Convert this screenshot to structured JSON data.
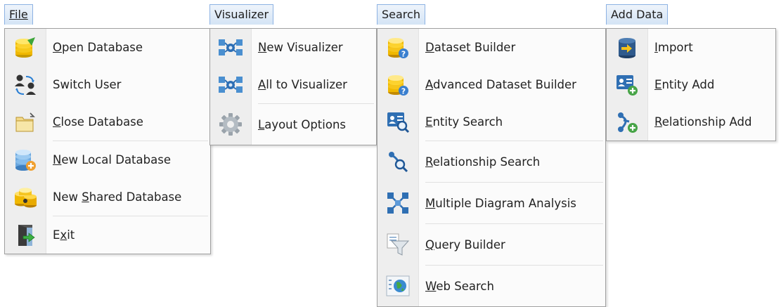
{
  "menus": {
    "file": {
      "title": "File",
      "items": [
        {
          "label": "Open Database",
          "mnemonic": "O",
          "icon": "open-database-icon"
        },
        {
          "label": "Switch User",
          "mnemonic": "",
          "icon": "switch-user-icon"
        },
        {
          "label": "Close Database",
          "mnemonic": "C",
          "icon": "close-database-icon"
        },
        {
          "label": "New Local Database",
          "mnemonic": "N",
          "icon": "new-local-database-icon"
        },
        {
          "label": "New Shared Database",
          "mnemonic": "S",
          "icon": "new-shared-database-icon"
        },
        {
          "label": "Exit",
          "mnemonic": "x",
          "icon": "exit-icon"
        }
      ]
    },
    "visualizer": {
      "title": "Visualizer",
      "items": [
        {
          "label": "New Visualizer",
          "mnemonic": "N",
          "icon": "new-visualizer-icon"
        },
        {
          "label": "All to Visualizer",
          "mnemonic": "A",
          "icon": "all-to-visualizer-icon"
        },
        {
          "label": "Layout Options",
          "mnemonic": "L",
          "icon": "gear-icon"
        }
      ]
    },
    "search": {
      "title": "Search",
      "items": [
        {
          "label": "Dataset Builder",
          "mnemonic": "D",
          "icon": "dataset-builder-icon"
        },
        {
          "label": "Advanced Dataset Builder",
          "mnemonic": "A",
          "icon": "advanced-dataset-builder-icon"
        },
        {
          "label": "Entity Search",
          "mnemonic": "E",
          "icon": "entity-search-icon"
        },
        {
          "label": "Relationship Search",
          "mnemonic": "R",
          "icon": "relationship-search-icon"
        },
        {
          "label": "Multiple Diagram Analysis",
          "mnemonic": "M",
          "icon": "multiple-diagram-icon"
        },
        {
          "label": "Query Builder",
          "mnemonic": "Q",
          "icon": "funnel-icon"
        },
        {
          "label": "Web Search",
          "mnemonic": "W",
          "icon": "globe-icon"
        }
      ]
    },
    "add_data": {
      "title": "Add Data",
      "items": [
        {
          "label": "Import",
          "mnemonic": "I",
          "icon": "import-icon"
        },
        {
          "label": "Entity Add",
          "mnemonic": "E",
          "icon": "entity-add-icon"
        },
        {
          "label": "Relationship Add",
          "mnemonic": "R",
          "icon": "relationship-add-icon"
        }
      ]
    }
  },
  "colors": {
    "menu_highlight": "#d4e4f5",
    "menu_border": "#8db2e3",
    "gutter": "#eeeeee"
  }
}
